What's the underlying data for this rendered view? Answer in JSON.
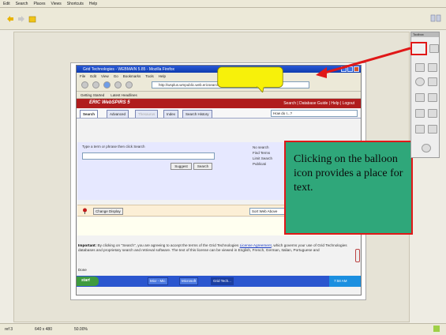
{
  "app": {
    "menu": [
      "Edit",
      "Search",
      "Places",
      "Views",
      "Shortcuts",
      "Help"
    ],
    "status": [
      "ref 3",
      "640 x 480",
      "50.00%"
    ]
  },
  "browser": {
    "title": "Grid Technologies - WEBMAIN 5.85 - Mozilla Firefox",
    "menu": [
      "File",
      "Edit",
      "View",
      "Go",
      "Bookmarks",
      "Tools",
      "Help"
    ],
    "address": "http://wsplus.wmpublic.web.ericsearch.bar",
    "links": [
      "Getting Started",
      "Latest Headlines"
    ],
    "eric_logo": "ERIC WebSPIRS 5",
    "eric_links": "Search | Database Guide | Help | Logout",
    "tabs": [
      "Search",
      "Advanced",
      "Thesaurus",
      "Index",
      "Search History"
    ],
    "how_select": "How do I...?",
    "search_hint": "Type a term or phrase then click Search",
    "suggest_label": "Suggest",
    "search_label": "Search",
    "right_options": [
      "No search",
      "Find Terms",
      "Limit Search",
      "Publicati"
    ],
    "change_display": "Change Display",
    "sort_select": "Sort Web Above",
    "legal_bold": "Important:",
    "legal_text": " By clicking on \"Search\", you are agreeing to accept the terms of the Grid Technologies ",
    "legal_link1": "License Agreement",
    "legal_text2": ", which governs your use of Grid Technologies databases and proprietary search and retrieval software. The text of this license can be viewed in English, French, German, Italian, Portuguese and",
    "done": "Done",
    "start": "start",
    "tasks": [
      "Micr - Mic",
      "Microsoft",
      "Grid Tech..."
    ],
    "clock": "7:58 AM"
  },
  "callout": {
    "text": "Clicking on the balloon icon provides a place for text."
  },
  "panel": {
    "header": "Toolbox"
  },
  "colors": {
    "callout_bg": "#2fa77a",
    "callout_border": "#e01818",
    "balloon": "#f7f10a",
    "arrow": "#e01818",
    "eric_bar": "#b01d1d"
  }
}
